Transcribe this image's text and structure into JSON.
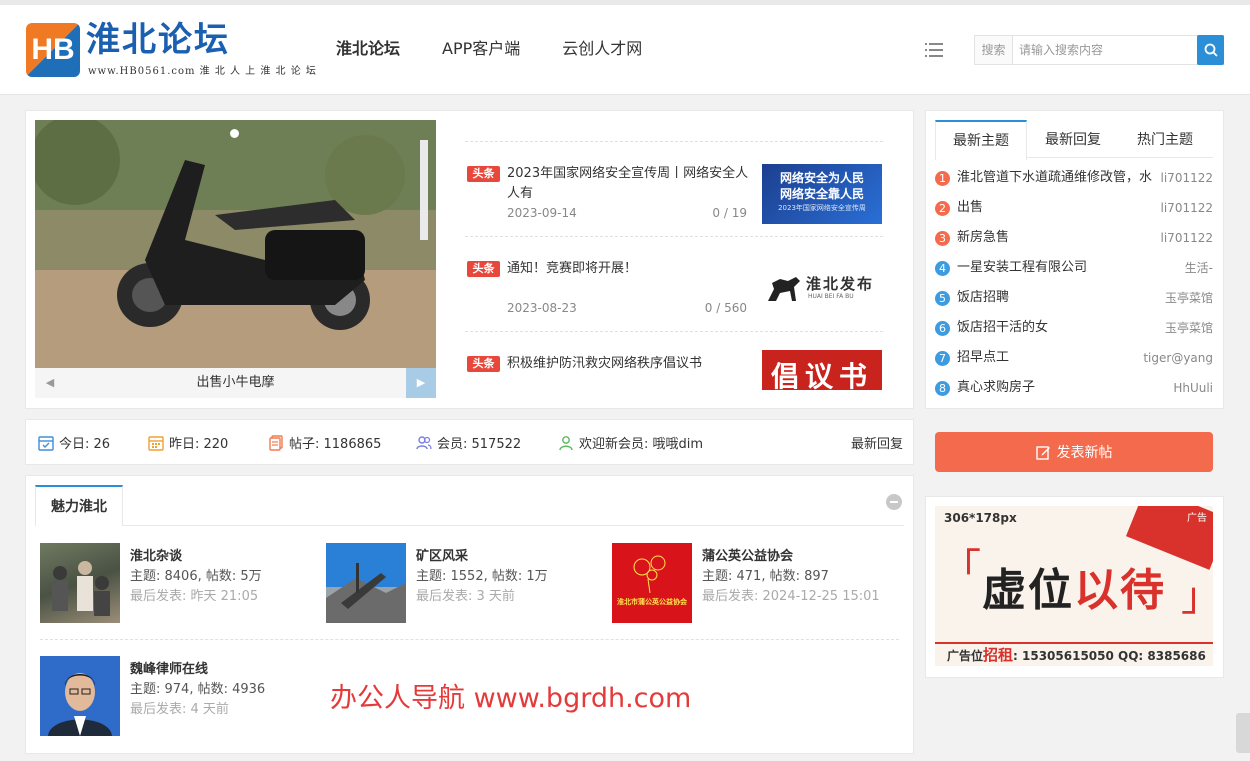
{
  "header": {
    "logo_mark": "HB",
    "logo_title": "淮北论坛",
    "logo_sub": "www.HB0561.com 淮 北 人 上 淮 北 论 坛",
    "nav": [
      "淮北论坛",
      "APP客户端",
      "云创人才网"
    ],
    "search_label": "搜索",
    "search_placeholder": "请输入搜索内容"
  },
  "slider": {
    "caption": "出售小牛电摩",
    "prev": "◀",
    "next": "▶"
  },
  "news": [
    {
      "tag": "头条",
      "title": "2023年国家网络安全宣传周丨网络安全人人有",
      "date": "2023-09-14",
      "count": "0 / 19",
      "img_line1": "网络安全为人民",
      "img_line2": "网络安全靠人民",
      "img_line3": "2023年国家网络安全宣传周"
    },
    {
      "tag": "头条",
      "title": "通知！竞赛即将开展！",
      "date": "2023-08-23",
      "count": "0 / 560",
      "img_line1": "淮北发布",
      "img_line2": "HUAI BEI FA BU"
    },
    {
      "tag": "头条",
      "title": "积极维护防汛救灾网络秩序倡议书",
      "img_line1": "倡议书"
    }
  ],
  "tabs": [
    "最新主题",
    "最新回复",
    "热门主题"
  ],
  "topics": [
    {
      "num": "1",
      "title": "淮北管道下水道疏通维修改管，水",
      "author": "li701122",
      "color": "#f36b4c"
    },
    {
      "num": "2",
      "title": "出售",
      "author": "li701122",
      "color": "#f36b4c"
    },
    {
      "num": "3",
      "title": "新房急售",
      "author": "li701122",
      "color": "#f36b4c"
    },
    {
      "num": "4",
      "title": "一星安装工程有限公司",
      "author": "生活-",
      "color": "#3d9be0"
    },
    {
      "num": "5",
      "title": "饭店招聘",
      "author": "玉亭菜馆",
      "color": "#3d9be0"
    },
    {
      "num": "6",
      "title": "饭店招干活的女",
      "author": "玉亭菜馆",
      "color": "#3d9be0"
    },
    {
      "num": "7",
      "title": "招早点工",
      "author": "tiger@yang",
      "color": "#3d9be0"
    },
    {
      "num": "8",
      "title": "真心求购房子",
      "author": "HhUuli",
      "color": "#3d9be0"
    }
  ],
  "stats": {
    "today": "今日: 26",
    "yesterday": "昨日: 220",
    "posts": "帖子: 1186865",
    "members": "会员: 517522",
    "welcome": "欢迎新会员: 哦哦dim",
    "latest_reply": "最新回复"
  },
  "post_button": "发表新帖",
  "forum": {
    "tab": "魅力淮北",
    "boards": [
      {
        "name": "淮北杂谈",
        "stats": "主题: 8406, 帖数: 5万",
        "last": "最后发表: 昨天 21:05"
      },
      {
        "name": "矿区风采",
        "stats": "主题: 1552, 帖数: 1万",
        "last": "最后发表: 3 天前"
      },
      {
        "name": "蒲公英公益协会",
        "stats": "主题: 471, 帖数: 897",
        "last": "最后发表: 2024-12-25 15:01",
        "img_text": "淮北市蒲公英公益协会"
      },
      {
        "name": "魏峰律师在线",
        "stats": "主题: 974, 帖数: 4936",
        "last": "最后发表: 4 天前"
      }
    ]
  },
  "watermark": "办公人导航 www.bgrdh.com",
  "ad": {
    "size": "306*178px",
    "corner": "广告",
    "text_a": "虚位",
    "text_b": "以待",
    "bracket_left": "「",
    "bracket_right": "」",
    "footer_a": "广告位",
    "footer_b": "招租",
    "footer_c": ": 15305615050  QQ: 8385686"
  },
  "colors": {
    "accent": "#2b8fd8",
    "post_button": "#f36b4c",
    "headline_tag": "#e8473b"
  }
}
